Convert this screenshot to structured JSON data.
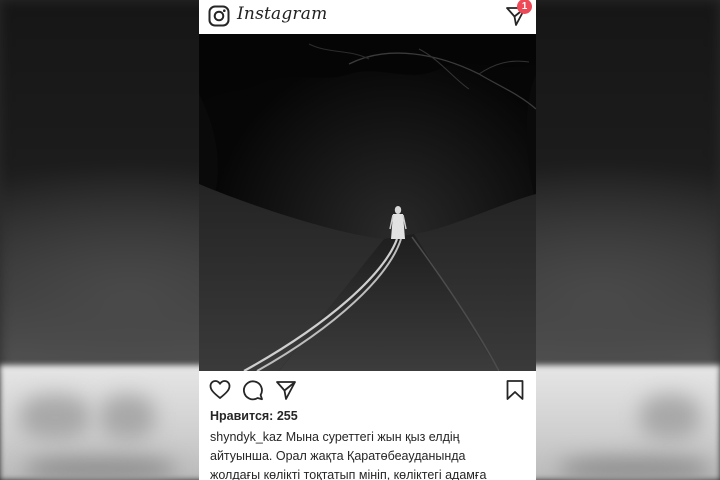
{
  "app": {
    "brand": "Instagram",
    "notification_count": "1"
  },
  "post": {
    "likes_text": "Нравится: 255",
    "username": "shyndyk_kaz",
    "caption_lines": [
      "Мына суреттегі жын қыз елдің",
      "айтуынша. Орал жақта Қаратөбеауданында",
      "жолдағы көлікті тоқтатып мініп, көліктегі адамға"
    ]
  },
  "icons": {
    "top_left": "camera-icon",
    "top_right": "direct-message-icon",
    "like": "heart-icon",
    "comment": "comment-icon",
    "share": "share-icon",
    "save": "bookmark-icon"
  },
  "colors": {
    "badge": "#ed4956",
    "text": "#262626"
  }
}
